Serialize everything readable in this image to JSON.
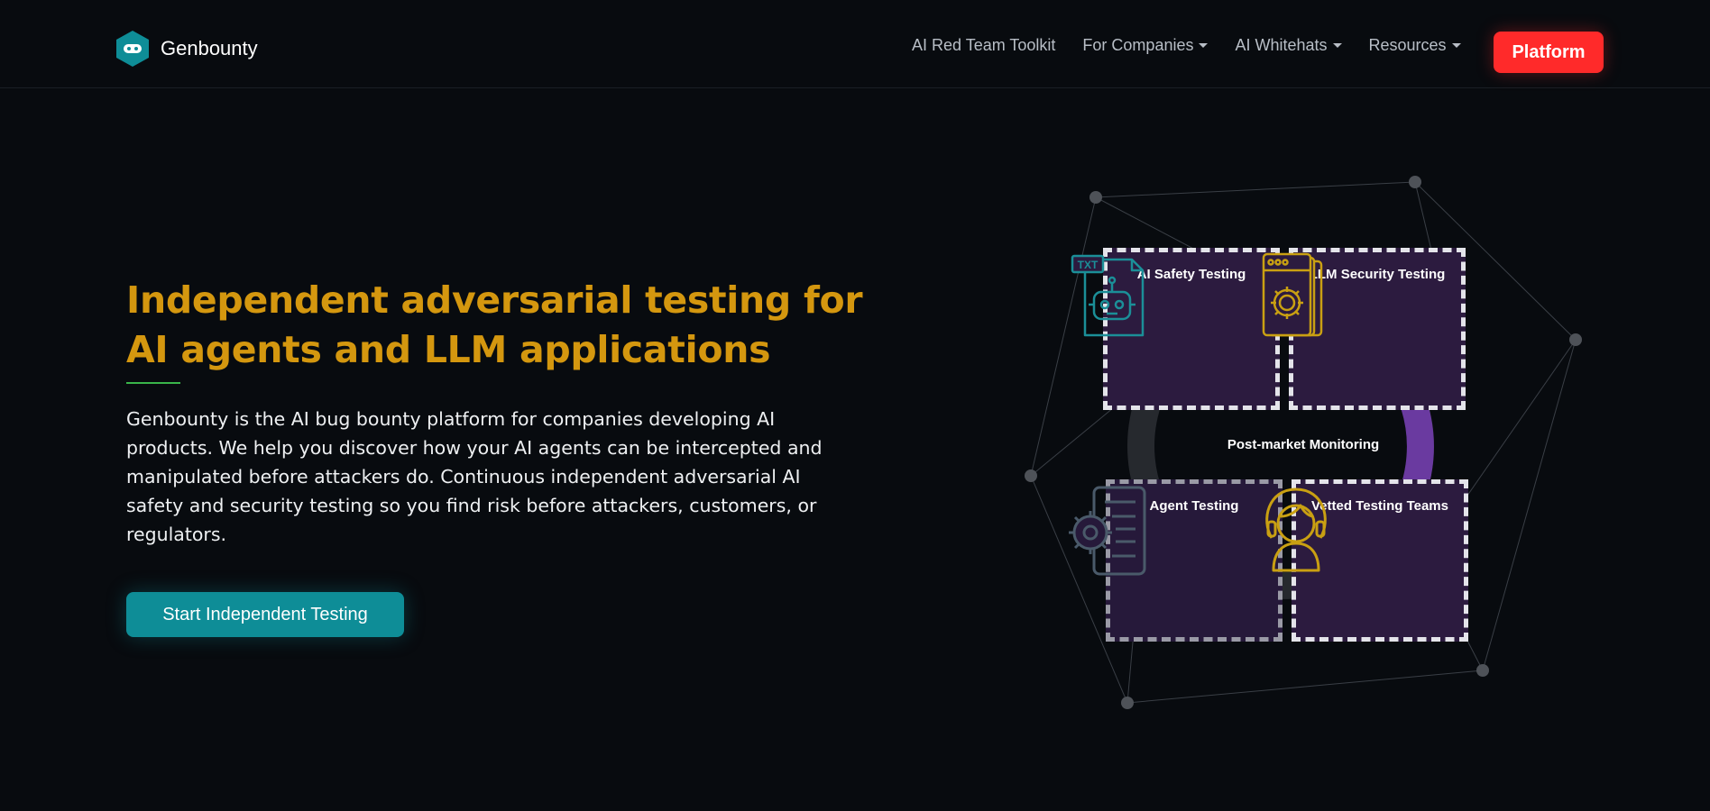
{
  "nav": {
    "brand": "Genbounty",
    "links": [
      {
        "label": "AI Red Team Toolkit",
        "has_dropdown": false
      },
      {
        "label": "For Companies",
        "has_dropdown": true
      },
      {
        "label": "AI Whitehats",
        "has_dropdown": true
      },
      {
        "label": "Resources",
        "has_dropdown": true
      }
    ],
    "platform_button": "Platform"
  },
  "hero": {
    "title": "Independent adversarial testing for AI agents and LLM applications",
    "description": "Genbounty is the AI bug bounty platform for companies developing AI products. We help you discover how your AI agents can be intercepted and manipulated before attackers do. Continuous independent adversarial AI safety and security testing so you find risk before attackers, customers, or regulators.",
    "cta": "Start Independent Testing"
  },
  "diagram": {
    "cards": [
      {
        "title": "AI Safety Testing",
        "icon": "robot-document-icon"
      },
      {
        "title": "LLM Security Testing",
        "icon": "browser-gear-icon"
      },
      {
        "title": "Agent Testing",
        "icon": "document-gear-icon"
      },
      {
        "title": "Vetted Testing Teams",
        "icon": "person-headset-icon"
      }
    ],
    "center_label": "Post-market Monitoring",
    "txt_badge": "TXT"
  },
  "colors": {
    "background": "#080b0f",
    "title_gold": "#d4970f",
    "accent_red": "#ff2a2a",
    "accent_teal": "#0e8d97",
    "underline_green": "#39b54a",
    "card_purple": "#2c1b3f"
  }
}
